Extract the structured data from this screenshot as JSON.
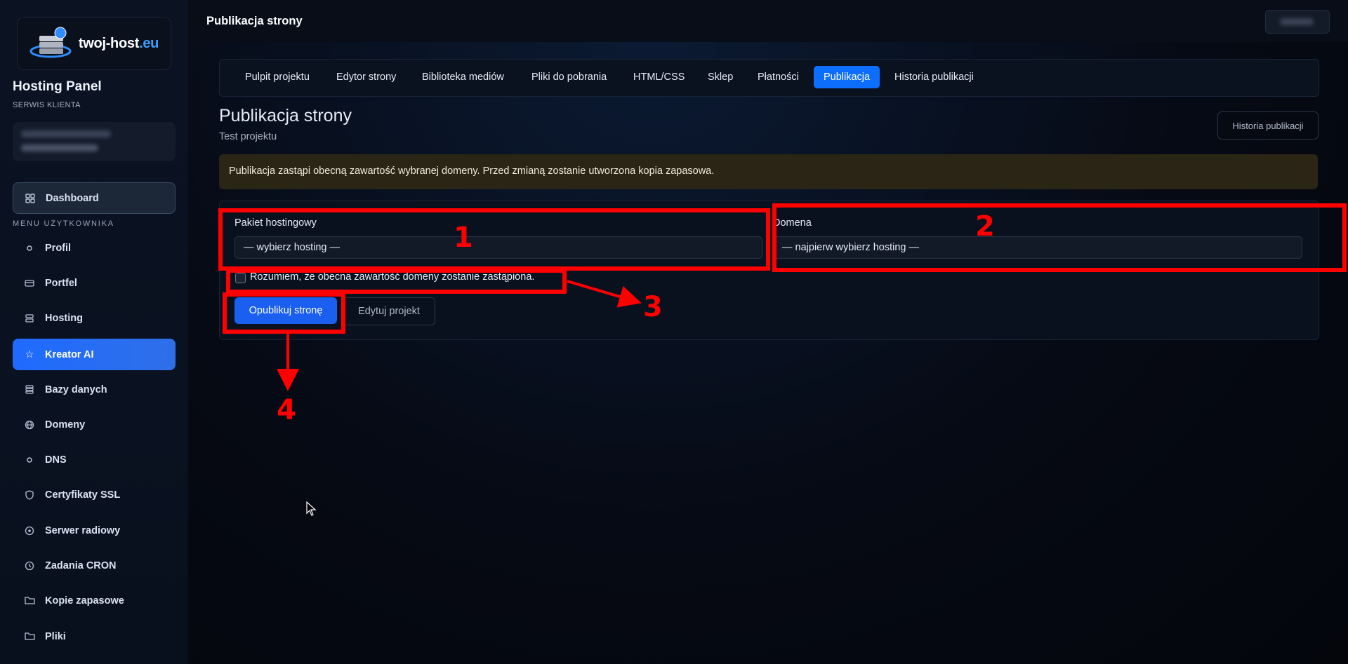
{
  "sidebar": {
    "logo": {
      "text_main": "twoj-host",
      "text_suffix": ".eu",
      "icon": "server-globe-icon"
    },
    "panel_title": "Hosting Panel",
    "panel_subtitle": "SERWIS KLIENTA",
    "dashboard_label": "Dashboard",
    "menu_label": "MENU UŻYTKOWNIKA",
    "items": [
      {
        "label": "Profil",
        "icon": "dot-icon"
      },
      {
        "label": "Portfel",
        "icon": "wallet-icon"
      },
      {
        "label": "Hosting",
        "icon": "server-icon"
      },
      {
        "label": "Kreator AI",
        "icon": "star-icon",
        "active": true
      },
      {
        "label": "Bazy danych",
        "icon": "database-icon"
      },
      {
        "label": "Domeny",
        "icon": "globe-icon"
      },
      {
        "label": "DNS",
        "icon": "dot-icon"
      },
      {
        "label": "Certyfikaty SSL",
        "icon": "shield-icon"
      },
      {
        "label": "Serwer radiowy",
        "icon": "radio-icon"
      },
      {
        "label": "Zadania CRON",
        "icon": "clock-icon"
      },
      {
        "label": "Kopie zapasowe",
        "icon": "folder-icon"
      },
      {
        "label": "Pliki",
        "icon": "folder-icon"
      }
    ]
  },
  "topbar": {
    "title": "Publikacja strony"
  },
  "tabs": [
    {
      "label": "Pulpit projektu"
    },
    {
      "label": "Edytor strony"
    },
    {
      "label": "Biblioteka mediów"
    },
    {
      "label": "Pliki do pobrania"
    },
    {
      "label": "HTML/CSS"
    },
    {
      "label": "Sklep"
    },
    {
      "label": "Płatności"
    },
    {
      "label": "Publikacja",
      "active": true
    },
    {
      "label": "Historia publikacji"
    }
  ],
  "page": {
    "title": "Publikacja strony",
    "subtitle": "Test projektu",
    "history_button": "Historia publikacji",
    "alert": "Publikacja zastąpi obecną zawartość wybranej domeny. Przed zmianą zostanie utworzona kopia zapasowa."
  },
  "form": {
    "hosting_label": "Pakiet hostingowy",
    "hosting_value": "— wybierz hosting —",
    "domain_label": "Domena",
    "domain_value": "— najpierw wybierz hosting —",
    "confirm_label": "Rozumiem, że obecna zawartość domeny zostanie zastąpiona.",
    "confirm_checked": false,
    "publish_button": "Opublikuj stronę",
    "edit_button": "Edytuj projekt"
  },
  "annotations": {
    "numbers": [
      "1",
      "2",
      "3",
      "4"
    ],
    "color": "#ff0000"
  },
  "colors": {
    "accent": "#0d6efd",
    "sidebar_active": "#1f6bff",
    "alert_bg": "#2a2515"
  }
}
